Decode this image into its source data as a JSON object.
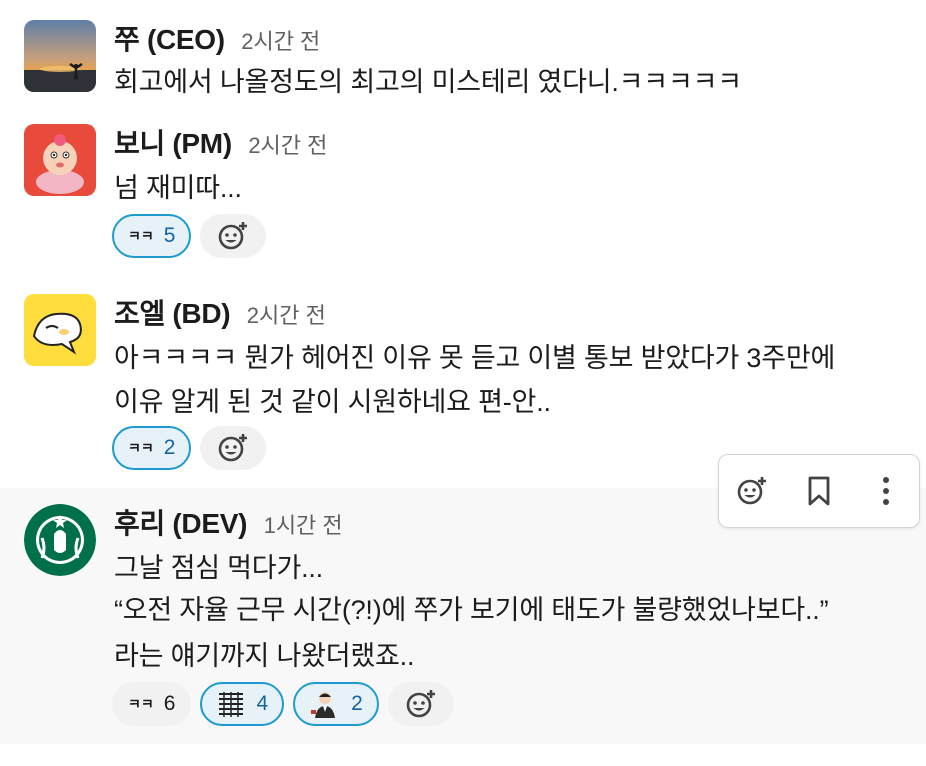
{
  "messages": [
    {
      "name": "쭈 (CEO)",
      "time": "2시간 전",
      "lines": [
        "회고에서 나올정도의 최고의 미스테리 였다니.ㅋㅋㅋㅋㅋ"
      ],
      "reactions": []
    },
    {
      "name": "보니 (PM)",
      "time": "2시간 전",
      "lines": [
        "넘 재미따..."
      ],
      "reactions": [
        {
          "emoji_label": "ㅋㅋ",
          "count": "5",
          "active": true
        }
      ]
    },
    {
      "name": "조엘 (BD)",
      "time": "2시간 전",
      "lines": [
        "아ㅋㅋㅋㅋ 뭔가 헤어진 이유 못 듣고 이별 통보 받았다가 3주만에",
        "이유 알게 된 것 같이 시원하네요 편-안.."
      ],
      "reactions": [
        {
          "emoji_label": "ㅋㅋ",
          "count": "2",
          "active": true
        }
      ]
    },
    {
      "name": "후리 (DEV)",
      "time": "1시간 전",
      "lines": [
        "그날 점심 먹다가...",
        "“오전 자율 근무 시간(?!)에 쭈가 보기에 태도가 불량했었나보다..”",
        "라는 얘기까지 나왔더랬죠.."
      ],
      "reactions": [
        {
          "emoji_label": "ㅋㅋ",
          "count": "6",
          "active": false
        },
        {
          "emoji_icon": "stacked-lines-emoji",
          "count": "4",
          "active": true
        },
        {
          "emoji_icon": "person-emoji",
          "count": "2",
          "active": true
        }
      ]
    }
  ],
  "hover_toolbar": {
    "buttons": [
      "add-reaction",
      "save",
      "more-actions"
    ]
  },
  "colors": {
    "active_border": "#1d9bd1",
    "active_bg": "#e6f1f8",
    "active_count": "#1264a3",
    "hover_bg": "#f8f8f8"
  }
}
